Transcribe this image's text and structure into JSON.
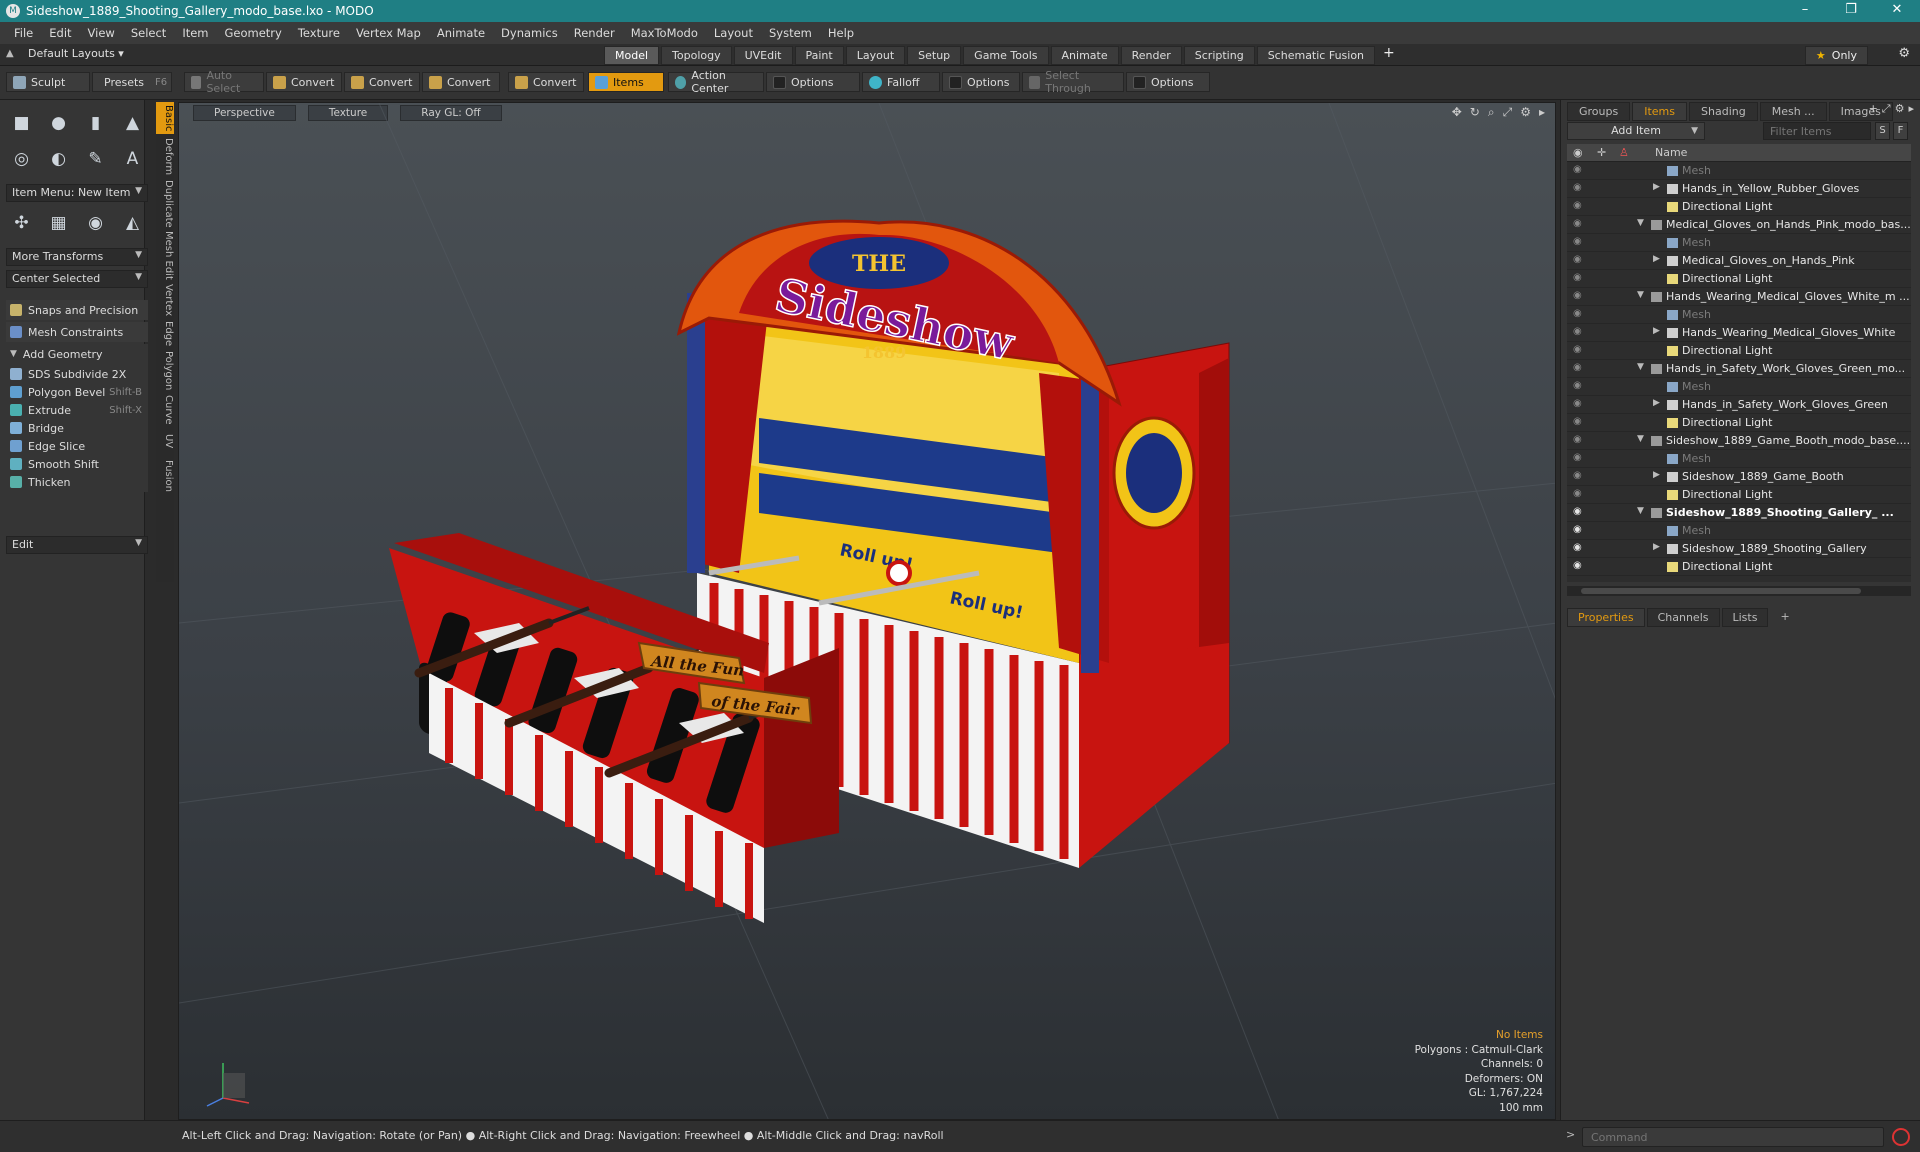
{
  "window": {
    "title": "Sideshow_1889_Shooting_Gallery_modo_base.lxo - MODO",
    "controls": [
      "–",
      "❐",
      "✕"
    ]
  },
  "menu": [
    "File",
    "Edit",
    "View",
    "Select",
    "Item",
    "Geometry",
    "Texture",
    "Vertex Map",
    "Animate",
    "Dynamics",
    "Render",
    "MaxToModo",
    "Layout",
    "System",
    "Help"
  ],
  "layout_selector": "Default Layouts ▾",
  "mode_tabs": [
    "Model",
    "Topology",
    "UVEdit",
    "Paint",
    "Layout",
    "Setup",
    "Game Tools",
    "Animate",
    "Render",
    "Scripting",
    "Schematic Fusion"
  ],
  "active_mode_tab": "Model",
  "only_label": "Only",
  "toolbar": {
    "sculpt": "Sculpt",
    "presets": "Presets",
    "presets_key": "F6",
    "auto_select": "Auto Select",
    "convert1": "Convert",
    "convert2": "Convert",
    "convert3": "Convert",
    "convert4": "Convert",
    "items": "Items",
    "action_center": "Action Center",
    "options1": "Options",
    "falloff": "Falloff",
    "options2": "Options",
    "select_through": "Select Through",
    "options3": "Options"
  },
  "left": {
    "item_menu": "Item Menu: New Item",
    "more_transforms": "More Transforms",
    "center_selected": "Center Selected",
    "snaps": "Snaps and Precision",
    "mesh_constraints": "Mesh Constraints",
    "add_geometry": "Add Geometry",
    "tools": [
      {
        "label": "SDS Subdivide 2X",
        "key": ""
      },
      {
        "label": "Polygon Bevel",
        "key": "Shift-B"
      },
      {
        "label": "Extrude",
        "key": "Shift-X"
      },
      {
        "label": "Bridge",
        "key": ""
      },
      {
        "label": "Edge Slice",
        "key": ""
      },
      {
        "label": "Smooth Shift",
        "key": ""
      },
      {
        "label": "Thicken",
        "key": ""
      }
    ],
    "edit": "Edit"
  },
  "vtabs": [
    "Basic",
    "Deform",
    "Duplicate",
    "Mesh Edit",
    "Vertex",
    "Edge",
    "Polygon",
    "Curve",
    "UV",
    "Fusion"
  ],
  "viewport": {
    "view": "Perspective",
    "shading": "Texture",
    "raygl": "Ray GL: Off",
    "stats": {
      "no_items": "No Items",
      "polygons": "Polygons : Catmull-Clark",
      "channels": "Channels: 0",
      "deformers": "Deformers: ON",
      "gl": "GL: 1,767,224",
      "scale": "100 mm"
    },
    "sign": {
      "the": "THE",
      "title": "Sideshow",
      "year": "1889",
      "rollup": "Roll up!",
      "fun1": "All the Fun",
      "fun2": "of the Fair"
    }
  },
  "right": {
    "tabs": [
      "Groups",
      "Items",
      "Shading",
      "Mesh ...",
      "Images"
    ],
    "active_tab": "Items",
    "add_item": "Add Item",
    "filter_placeholder": "Filter Items",
    "s_btn": "S",
    "f_btn": "F",
    "name_col": "Name",
    "rows": [
      {
        "label": "Mesh",
        "type": "mesh",
        "indent": 2,
        "dim": true
      },
      {
        "label": "Hands_in_Yellow_Rubber_Gloves",
        "type": "group",
        "indent": 2,
        "tri": "▶"
      },
      {
        "label": "Directional Light",
        "type": "light",
        "indent": 2
      },
      {
        "label": "Medical_Gloves_on_Hands_Pink_modo_bas...",
        "type": "scene",
        "indent": 1,
        "tri": "▼"
      },
      {
        "label": "Mesh",
        "type": "mesh",
        "indent": 2,
        "dim": true
      },
      {
        "label": "Medical_Gloves_on_Hands_Pink",
        "type": "group",
        "indent": 2,
        "tri": "▶"
      },
      {
        "label": "Directional Light",
        "type": "light",
        "indent": 2
      },
      {
        "label": "Hands_Wearing_Medical_Gloves_White_m ...",
        "type": "scene",
        "indent": 1,
        "tri": "▼"
      },
      {
        "label": "Mesh",
        "type": "mesh",
        "indent": 2,
        "dim": true
      },
      {
        "label": "Hands_Wearing_Medical_Gloves_White",
        "type": "group",
        "indent": 2,
        "tri": "▶"
      },
      {
        "label": "Directional Light",
        "type": "light",
        "indent": 2
      },
      {
        "label": "Hands_in_Safety_Work_Gloves_Green_mo...",
        "type": "scene",
        "indent": 1,
        "tri": "▼"
      },
      {
        "label": "Mesh",
        "type": "mesh",
        "indent": 2,
        "dim": true
      },
      {
        "label": "Hands_in_Safety_Work_Gloves_Green",
        "type": "group",
        "indent": 2,
        "tri": "▶"
      },
      {
        "label": "Directional Light",
        "type": "light",
        "indent": 2
      },
      {
        "label": "Sideshow_1889_Game_Booth_modo_base....",
        "type": "scene",
        "indent": 1,
        "tri": "▼"
      },
      {
        "label": "Mesh",
        "type": "mesh",
        "indent": 2,
        "dim": true
      },
      {
        "label": "Sideshow_1889_Game_Booth",
        "type": "group",
        "indent": 2,
        "tri": "▶"
      },
      {
        "label": "Directional Light",
        "type": "light",
        "indent": 2
      },
      {
        "label": "Sideshow_1889_Shooting_Gallery_ ...",
        "type": "scene",
        "indent": 1,
        "tri": "▼",
        "bold": true,
        "eye_on": true
      },
      {
        "label": "Mesh",
        "type": "mesh",
        "indent": 2,
        "dim": true,
        "eye_on": true
      },
      {
        "label": "Sideshow_1889_Shooting_Gallery",
        "type": "group",
        "indent": 2,
        "tri": "▶",
        "eye_on": true
      },
      {
        "label": "Directional Light",
        "type": "light",
        "indent": 2,
        "eye_on": true
      }
    ],
    "prop_tabs": [
      "Properties",
      "Channels",
      "Lists"
    ],
    "active_prop_tab": "Properties"
  },
  "status": {
    "message": "Alt-Left Click and Drag: Navigation: Rotate (or Pan) ● Alt-Right Click and Drag: Navigation: Freewheel ● Alt-Middle Click and Drag: navRoll",
    "command_placeholder": "Command"
  },
  "colors": {
    "accent": "#e39a10",
    "titlebar": "#1f7f84",
    "booth_red": "#c81410",
    "booth_yellow": "#f2c417"
  }
}
